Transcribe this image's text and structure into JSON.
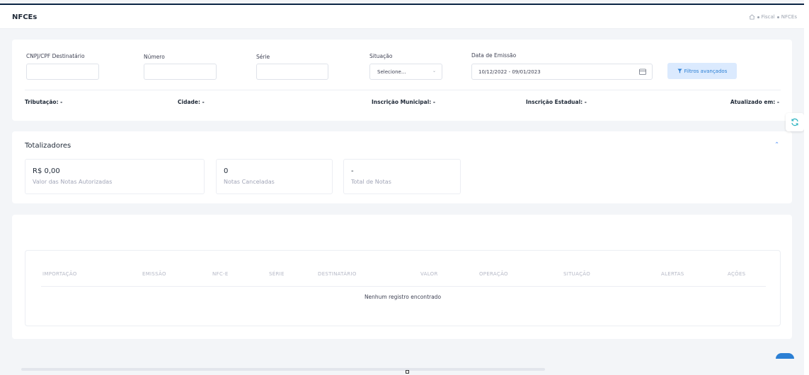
{
  "header": {
    "title": "NFCEs",
    "breadcrumb": [
      "Fiscal",
      "NFCEs"
    ]
  },
  "filters": {
    "cnpj_label": "CNPJ/CPF Destinatário",
    "cnpj_value": "",
    "numero_label": "Número",
    "numero_value": "",
    "serie_label": "Série",
    "serie_value": "",
    "situacao_label": "Situação",
    "situacao_selected": "Selecione...",
    "data_label": "Data de Emissão",
    "data_value": "10/12/2022 - 09/01/2023",
    "advanced_button": "Filtros avançados"
  },
  "info": {
    "tributacao": "Tributação: -",
    "cidade": "Cidade: -",
    "inscricao_municipal": "Inscrição Municipal: -",
    "inscricao_estadual": "Inscrição Estadual: -",
    "atualizado": "Atualizado em: -"
  },
  "totalizadores": {
    "title": "Totalizadores",
    "stats": [
      {
        "value": "R$ 0,00",
        "label": "Valor das Notas Autorizadas"
      },
      {
        "value": "0",
        "label": "Notas Canceladas"
      },
      {
        "value": "-",
        "label": "Total de Notas"
      }
    ]
  },
  "table": {
    "columns": [
      "IMPORTAÇÃO",
      "EMISSÃO",
      "NFC-E",
      "SÉRIE",
      "DESTINATÁRIO",
      "VALOR",
      "OPERAÇÃO",
      "SITUAÇÃO",
      "ALERTAS",
      "AÇÕES"
    ],
    "empty_message": "Nenhum registro encontrado"
  },
  "icons": {
    "home": "home-icon",
    "calendar": "calendar-icon",
    "filter": "filter-icon",
    "refresh": "refresh-icon",
    "collapse": "chevron-up-icon"
  },
  "colors": {
    "accent": "#2b7fd4",
    "accent_light": "#dbeafe",
    "header_line": "#0b2545"
  }
}
